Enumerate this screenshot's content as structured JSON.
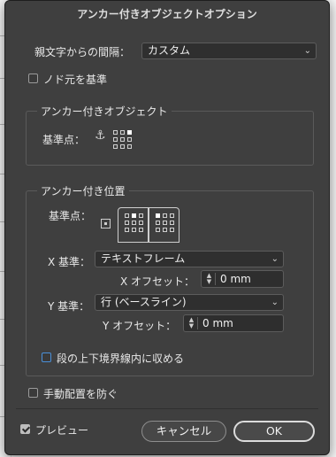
{
  "dialog": {
    "title": "アンカー付きオブジェクトオプション"
  },
  "spacing": {
    "label": "親文字からの間隔：",
    "value": "カスタム"
  },
  "inline_base": {
    "label": "ノド元を基準",
    "checked": false
  },
  "anchored_object": {
    "group_title": "アンカー付きオブジェクト",
    "ref_point_label": "基準点：",
    "icon": "anchor-icon"
  },
  "anchored_position": {
    "group_title": "アンカー付き位置",
    "ref_point_label": "基準点：",
    "x_base": {
      "label": "X 基準：",
      "value": "テキストフレーム"
    },
    "x_offset": {
      "label": "X オフセット：",
      "value": "0 mm"
    },
    "y_base": {
      "label": "Y 基準：",
      "value": "行 (ベースライン)"
    },
    "y_offset": {
      "label": "Y オフセット：",
      "value": "0 mm"
    },
    "keep_within": {
      "label": "段の上下境界線内に収める",
      "checked": false
    }
  },
  "prevent_manual": {
    "label": "手動配置を防ぐ",
    "checked": false
  },
  "preview": {
    "label": "プレビュー",
    "checked": true
  },
  "buttons": {
    "cancel": "キャンセル",
    "ok": "OK"
  },
  "icons": {
    "chevron": "⌄",
    "stepper_up": "▲",
    "stepper_down": "▼"
  }
}
